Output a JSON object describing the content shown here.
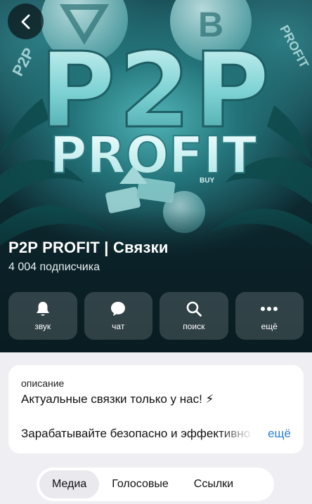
{
  "cover": {
    "big_title": "P2P",
    "sub_title": "PROFIT",
    "side_text_left": "P2P",
    "side_text_right": "PROFIT",
    "small_tag": "BUY"
  },
  "channel": {
    "title": "P2P PROFIT | Связки",
    "subscribers": "4 004 подписчика"
  },
  "actions": [
    {
      "label": "звук",
      "icon": "bell-icon"
    },
    {
      "label": "чат",
      "icon": "chat-bubble-icon"
    },
    {
      "label": "поиск",
      "icon": "search-icon"
    },
    {
      "label": "ещё",
      "icon": "more-dots-icon"
    }
  ],
  "description": {
    "label": "описание",
    "line1": "Актуальные связки только у нас! ⚡",
    "line2": "Зарабатывайте безопасно и эффективно",
    "more": "ещё"
  },
  "tabs": [
    {
      "label": "Медиа",
      "active": true
    },
    {
      "label": "Голосовые",
      "active": false
    },
    {
      "label": "Ссылки",
      "active": false
    }
  ],
  "colors": {
    "accent_link": "#2f7fd8",
    "cover_teal": "#23747a",
    "cover_dark": "#0a1f25"
  }
}
